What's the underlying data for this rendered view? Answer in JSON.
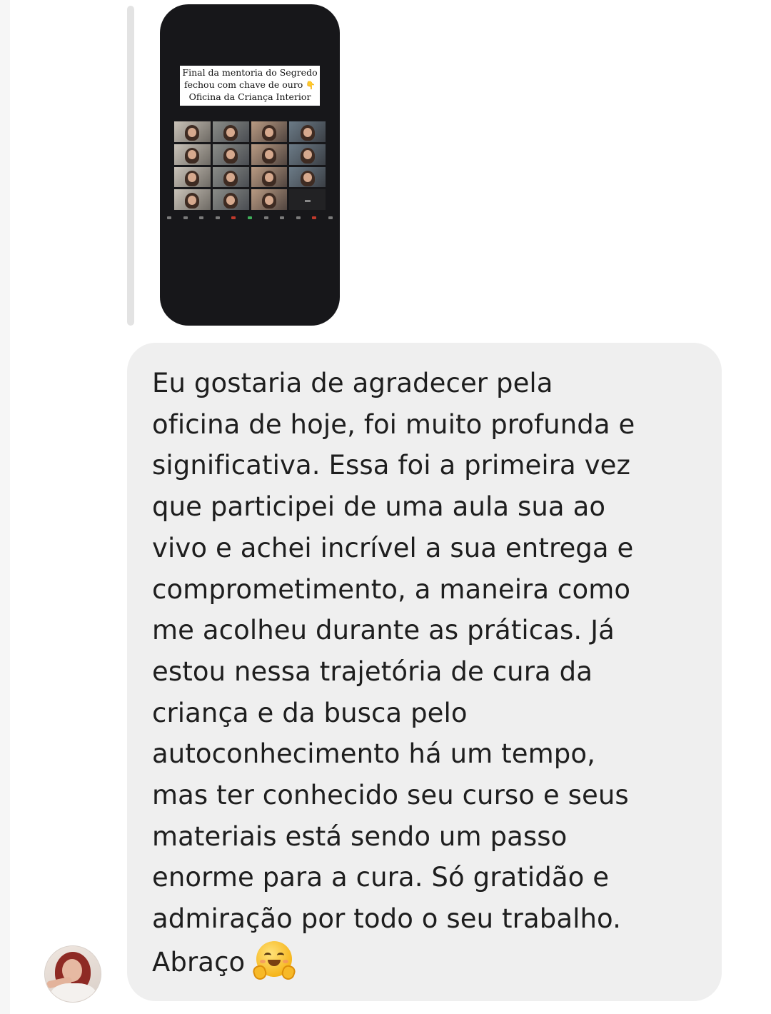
{
  "story_reply": {
    "caption_lines": [
      "Final da mentoria do Segredo",
      "fechou com chave de ouro",
      "Oficina da Criança Interior"
    ],
    "caption_emoji": "👇",
    "video_tiles": 16,
    "empty_tiles": [
      15
    ]
  },
  "message": {
    "lines": [
      "Eu gostaria de agradecer pela",
      "oficina de hoje, foi muito profunda e",
      "significativa. Essa foi a primeira vez",
      "que participei de uma aula sua ao",
      "vivo e achei incrível a sua entrega e",
      "comprometimento, a maneira como",
      "me acolheu durante as práticas. Já",
      "estou nessa trajetória de cura da",
      "criança e da busca pelo",
      "autoconhecimento há um tempo,",
      "mas ter conhecido seu curso e seus",
      "materiais está sendo um passo",
      "enorme para a cura. Só gratidão e",
      "admiração por todo o seu trabalho."
    ],
    "closing": "Abraço",
    "closing_emoji": "hugging-face"
  },
  "colors": {
    "bubble": "#efefef",
    "text": "#1e1e1e",
    "story_bg": "#17171a",
    "reply_line": "#e3e3e3"
  }
}
